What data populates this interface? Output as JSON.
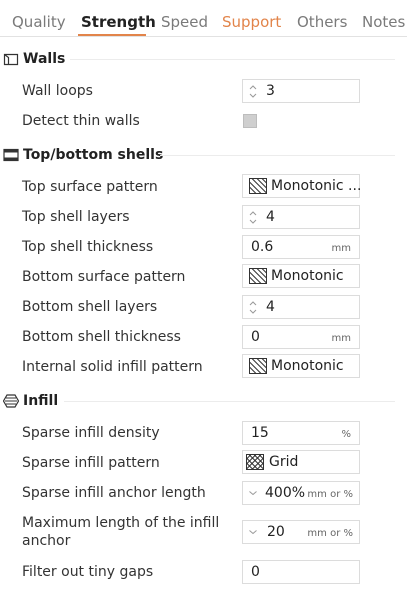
{
  "tabs": [
    {
      "label": "Quality"
    },
    {
      "label": "Strength"
    },
    {
      "label": "Speed"
    },
    {
      "label": "Support"
    },
    {
      "label": "Others"
    },
    {
      "label": "Notes"
    }
  ],
  "active_tab": "Strength",
  "accent_color": "#e2844a",
  "sections": {
    "walls": {
      "title": "Walls",
      "icon": "walls-icon",
      "wall_loops": {
        "label": "Wall loops",
        "value": "3"
      },
      "detect_thin_walls": {
        "label": "Detect thin walls",
        "checked": false
      }
    },
    "shells": {
      "title": "Top/bottom shells",
      "icon": "shells-icon",
      "top_surface_pattern": {
        "label": "Top surface pattern",
        "value": "Monotonic ..."
      },
      "top_shell_layers": {
        "label": "Top shell layers",
        "value": "4"
      },
      "top_shell_thickness": {
        "label": "Top shell thickness",
        "value": "0.6",
        "unit": "mm"
      },
      "bottom_surface_pattern": {
        "label": "Bottom surface pattern",
        "value": "Monotonic"
      },
      "bottom_shell_layers": {
        "label": "Bottom shell layers",
        "value": "4"
      },
      "bottom_shell_thickness": {
        "label": "Bottom shell thickness",
        "value": "0",
        "unit": "mm"
      },
      "internal_solid_infill_pattern": {
        "label": "Internal solid infill pattern",
        "value": "Monotonic"
      }
    },
    "infill": {
      "title": "Infill",
      "icon": "infill-icon",
      "sparse_infill_density": {
        "label": "Sparse infill density",
        "value": "15",
        "unit": "%"
      },
      "sparse_infill_pattern": {
        "label": "Sparse infill pattern",
        "value": "Grid"
      },
      "sparse_infill_anchor_length": {
        "label": "Sparse infill anchor length",
        "value": "400%",
        "unit": "mm or %"
      },
      "max_infill_anchor": {
        "label": "Maximum length of the infill anchor",
        "value": "20",
        "unit": "mm or %"
      },
      "filter_tiny_gaps": {
        "label": "Filter out tiny gaps",
        "value": "0"
      }
    }
  }
}
